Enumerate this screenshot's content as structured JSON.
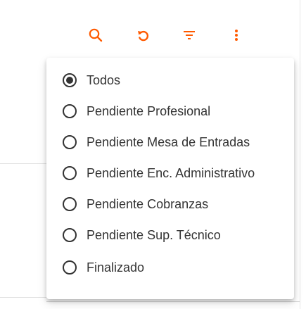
{
  "toolbar": {
    "icons": [
      "search-icon",
      "undo-icon",
      "filter-icon",
      "more-vert-icon"
    ],
    "icon_color": "#ff5a00"
  },
  "menu": {
    "options": [
      {
        "label": "Todos",
        "selected": true
      },
      {
        "label": "Pendiente Profesional",
        "selected": false
      },
      {
        "label": "Pendiente Mesa de Entradas",
        "selected": false
      },
      {
        "label": "Pendiente Enc. Administrativo",
        "selected": false
      },
      {
        "label": "Pendiente Cobranzas",
        "selected": false
      },
      {
        "label": "Pendiente Sup. Técnico",
        "selected": false
      },
      {
        "label": "Finalizado",
        "selected": false
      }
    ]
  }
}
